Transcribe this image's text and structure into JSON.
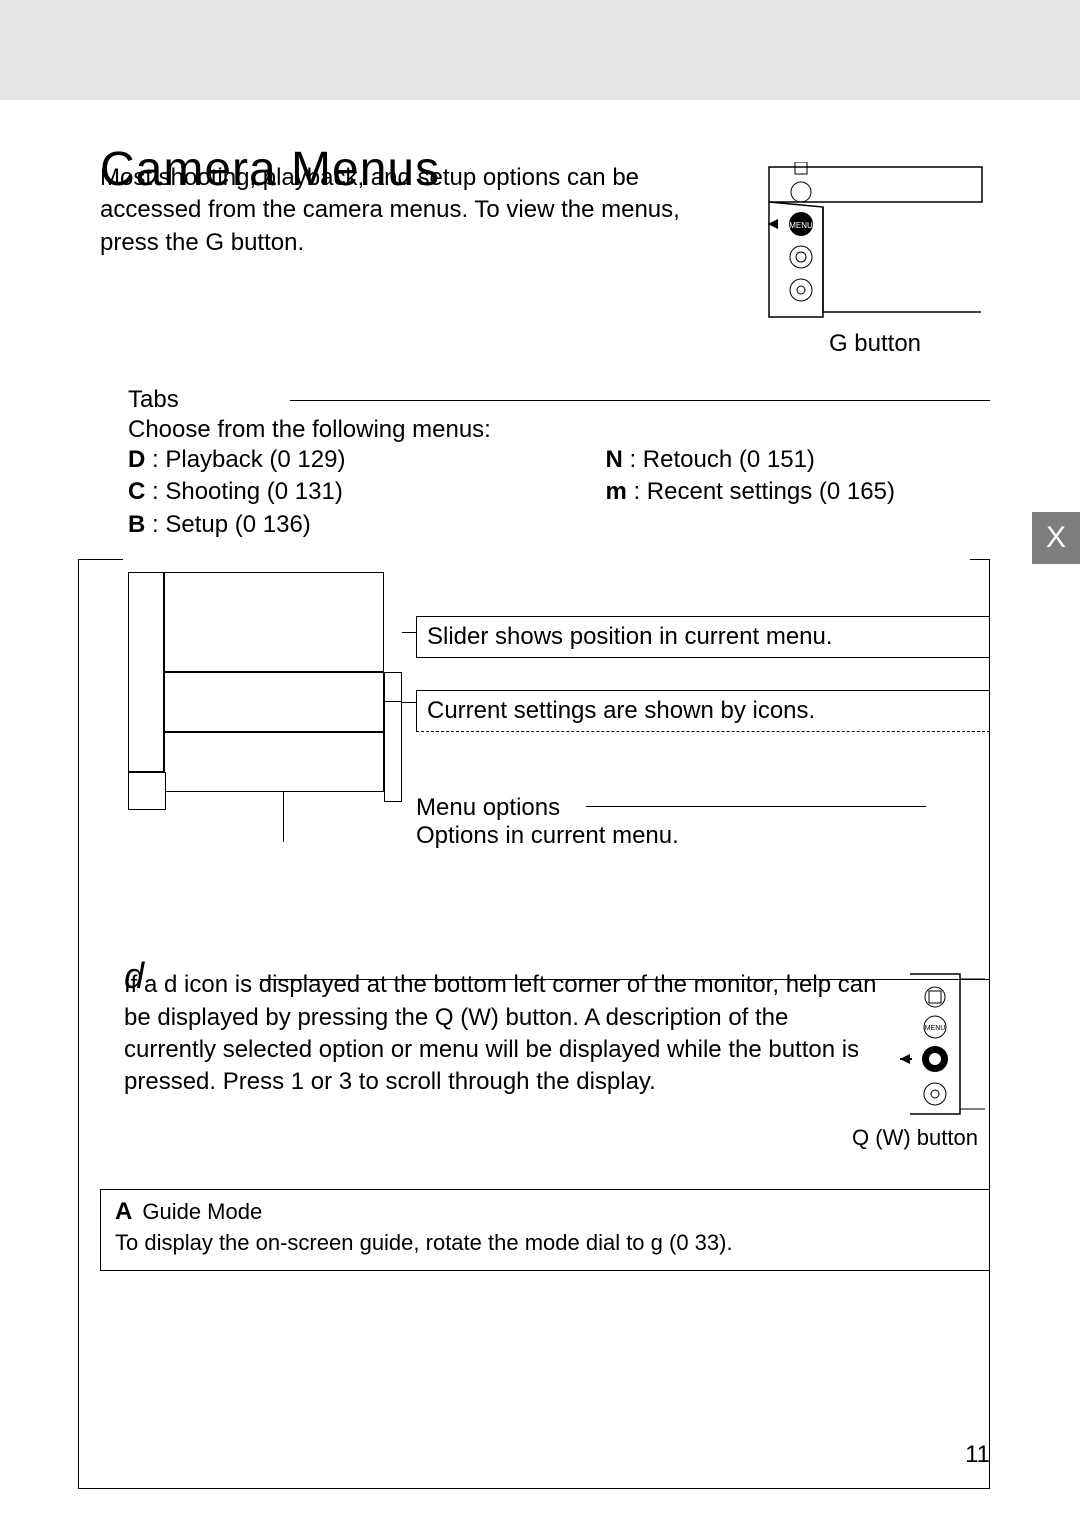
{
  "title": "Camera Menus",
  "intro": "Most shooting, playback, and setup options can be accessed from the camera menus.  To view the menus, press the G button.",
  "illus1_label": "G button",
  "side_tab": "X",
  "tabs": {
    "heading": "Tabs",
    "lead": "Choose from the following menus:",
    "left": [
      {
        "sym": "D",
        "label": ": Playback (0 129)"
      },
      {
        "sym": "C",
        "label": ": Shooting (0 131)"
      },
      {
        "sym": "B",
        "label": ": Setup (0 136)"
      }
    ],
    "right": [
      {
        "sym": "N",
        "label": ": Retouch (0 151)"
      },
      {
        "sym": "m",
        "label": ": Recent settings (0 165)"
      }
    ]
  },
  "diagram": {
    "callout_slider": "Slider shows position in current menu.",
    "callout_icons": "Current settings are shown by icons.",
    "menu_options_heading": "Menu options",
    "menu_options_text": "Options in current menu."
  },
  "help": {
    "icon": "d",
    "text": "If a d icon is displayed at the bottom left corner of the monitor, help can be displayed by pressing the Q (W) button. A description of the currently selected option or menu will be displayed while the button is pressed. Press 1 or 3 to scroll through the display.",
    "illus_label": "Q (W) button"
  },
  "guide": {
    "sym": "A",
    "title": "Guide Mode",
    "text": "To display the on-screen guide, rotate the mode dial to g (0 33)."
  },
  "page_no": "11"
}
